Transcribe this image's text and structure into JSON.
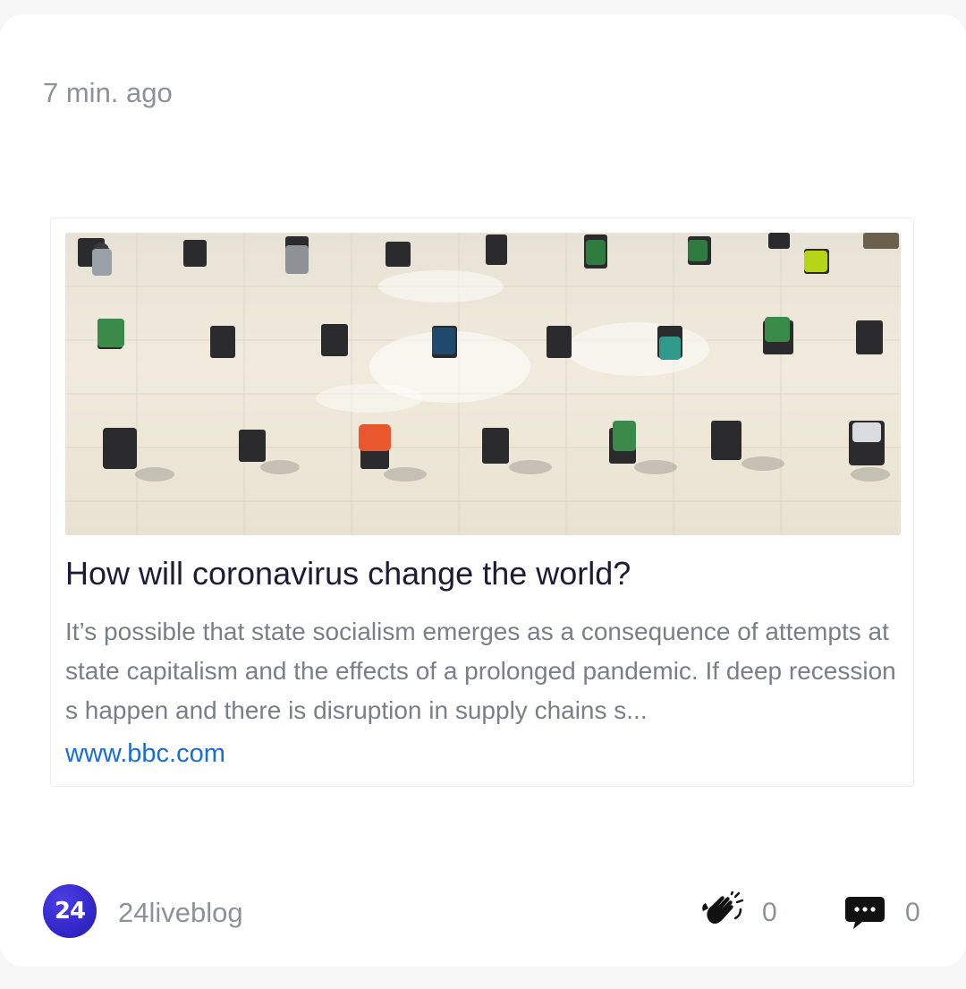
{
  "post": {
    "timestamp": "7 min. ago"
  },
  "link_preview": {
    "image_alt": "photo",
    "title": "How will coronavirus change the world?",
    "description": "It’s possible that state socialism emerges as a consequence of attempts at state capitalism and the effects of a prolonged pandemic. If deep recessions happen and there is disruption in supply chains s...",
    "domain": "www.bbc.com"
  },
  "footer": {
    "avatar_text": "24",
    "author": "24liveblog",
    "clap_icon": "clap-icon",
    "clap_count": "0",
    "comment_icon": "comment-icon",
    "comment_count": "0"
  },
  "colors": {
    "accent": "#1a6dd6",
    "avatar": "#3327c8",
    "title": "#1d1b36",
    "muted": "#8e9196"
  }
}
